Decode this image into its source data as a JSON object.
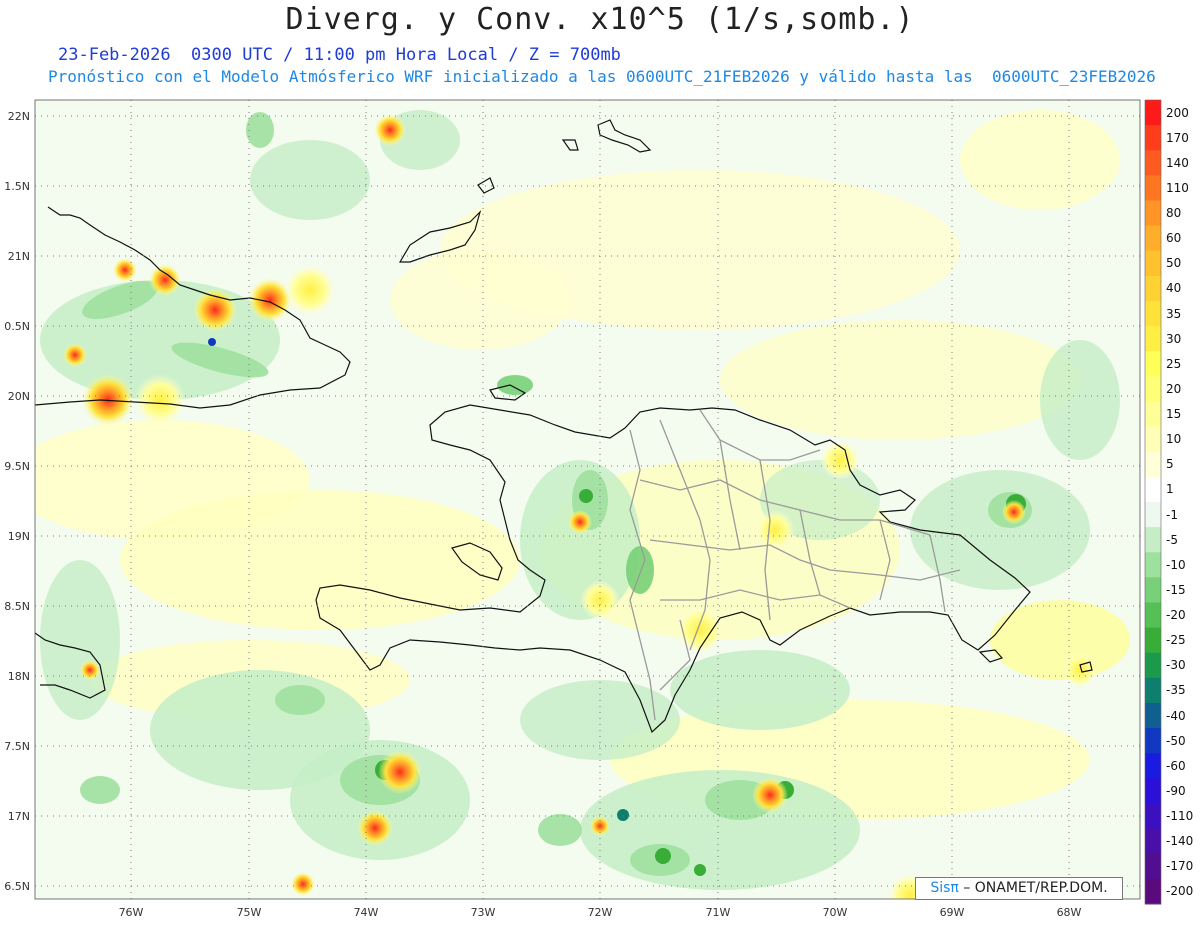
{
  "header": {
    "title": "Diverg. y Conv. x10^5 (1/s,somb.)",
    "subtitle_time": "23-Feb-2026  0300 UTC / 11:00 pm Hora Local / Z = 700mb",
    "subtitle_model": "Pronóstico con el Modelo Atmósferico WRF inicializado a las 0600UTC_21FEB2026 y válido hasta las  0600UTC_23FEB2026"
  },
  "map": {
    "lat_labels": [
      "22N",
      "1.5N",
      "21N",
      "0.5N",
      "20N",
      "9.5N",
      "19N",
      "8.5N",
      "18N",
      "7.5N",
      "17N",
      "6.5N"
    ],
    "lon_labels": [
      "76W",
      "75W",
      "74W",
      "73W",
      "72W",
      "71W",
      "70W",
      "69W",
      "68W"
    ],
    "lat_range": [
      16.5,
      22.0
    ],
    "lon_range": [
      -76.6,
      -67.6
    ]
  },
  "colorbar": {
    "labels": [
      "200",
      "170",
      "140",
      "110",
      "80",
      "60",
      "50",
      "40",
      "35",
      "30",
      "25",
      "20",
      "15",
      "10",
      "5",
      "1",
      "-1",
      "-5",
      "-10",
      "-15",
      "-20",
      "-25",
      "-30",
      "-35",
      "-40",
      "-50",
      "-60",
      "-90",
      "-110",
      "-140",
      "-170",
      "-200"
    ],
    "colors": [
      "#ff1a1a",
      "#ff3d1a",
      "#ff5a1f",
      "#ff7622",
      "#ff9526",
      "#ffae2c",
      "#ffc130",
      "#ffd233",
      "#ffe13a",
      "#ffef45",
      "#ffff5a",
      "#ffff78",
      "#ffff98",
      "#ffffb8",
      "#ffffd8",
      "#ffffff",
      "#eef8ee",
      "#c6eec6",
      "#9ee09e",
      "#78d078",
      "#55c055",
      "#38ad38",
      "#1a9a4a",
      "#0e7e6e",
      "#0f5f90",
      "#1038c0",
      "#1a1ae0",
      "#2a10d8",
      "#3a10c0",
      "#4810a8",
      "#520e90",
      "#5a0a7c"
    ]
  },
  "credit": {
    "brand": "Sisπ",
    "text": "– ONAMET/REP.DOM."
  }
}
